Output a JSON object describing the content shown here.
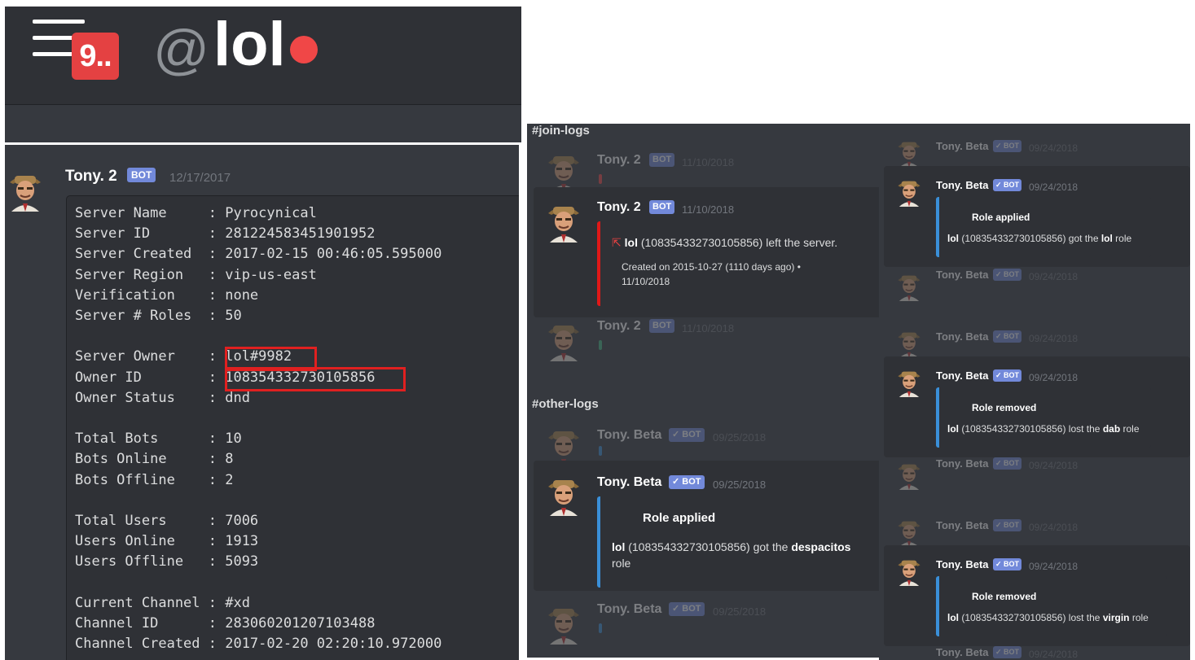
{
  "header": {
    "badge": "9..",
    "at_symbol": "@",
    "channel": "lol"
  },
  "serverinfo": {
    "author": "Tony. 2",
    "bot_tag": "BOT",
    "timestamp": "12/17/2017",
    "rows": [
      "Server Name     : Pyrocynical",
      "Server ID       : 281224583451901952",
      "Server Created  : 2017-02-15 00:46:05.595000",
      "Server Region   : vip-us-east",
      "Verification    : none",
      "Server # Roles  : 50",
      "",
      "Server Owner    : lol#9982",
      "Owner ID        : 108354332730105856",
      "Owner Status    : dnd",
      "",
      "Total Bots      : 10",
      "Bots Online     : 8",
      "Bots Offline    : 2",
      "",
      "Total Users     : 7006",
      "Users Online    : 1913",
      "Users Offline   : 5093",
      "",
      "Current Channel : #xd",
      "Channel ID      : 283060201207103488",
      "Channel Created : 2017-02-20 02:20:10.972000"
    ]
  },
  "logs": {
    "join_label": "#join-logs",
    "other_label": "#other-logs",
    "ghost1": {
      "author": "Tony. 2",
      "bot": "BOT",
      "ts": "11/10/2018"
    },
    "join_msg": {
      "author": "Tony. 2",
      "bot": "BOT",
      "ts": "11/10/2018",
      "user": "lol",
      "line1": " (108354332730105856) left the server.",
      "line2": "Created on 2015-10-27 (1110 days ago) •",
      "line3": "11/10/2018"
    },
    "ghost2": {
      "author": "Tony. 2",
      "bot": "BOT",
      "ts": "11/10/2018"
    },
    "ghost3": {
      "author": "Tony. Beta",
      "bot": "✓ BOT",
      "ts": "09/25/2018"
    },
    "other_msg": {
      "author": "Tony. Beta",
      "bot": "✓ BOT",
      "ts": "09/25/2018",
      "title": "Role applied",
      "user": "lol",
      "line1": " (108354332730105856) got the ",
      "role": "despacitos",
      "line2": "role"
    },
    "ghost4": {
      "author": "Tony. Beta",
      "bot": "✓ BOT",
      "ts": "09/25/2018"
    }
  },
  "roles": {
    "ghosts": [
      {
        "author": "Tony. Beta",
        "bot": "✓ BOT",
        "ts": "09/24/2018"
      }
    ],
    "messages": [
      {
        "author": "Tony. Beta",
        "bot": "✓ BOT",
        "ts": "09/24/2018",
        "title": "Role applied",
        "user": "lol",
        "text": " (108354332730105856) got the ",
        "role": "lol",
        "tail": " role"
      },
      {
        "author": "Tony. Beta",
        "bot": "✓ BOT",
        "ts": "09/24/2018",
        "title": "Role removed",
        "user": "lol",
        "text": " (108354332730105856) lost the ",
        "role": "dab",
        "tail": " role"
      },
      {
        "author": "Tony. Beta",
        "bot": "✓ BOT",
        "ts": "09/24/2018",
        "title": "Role removed",
        "user": "lol",
        "text": " (108354332730105856) lost the ",
        "role": "virgin",
        "tail": " role"
      }
    ]
  },
  "colors": {
    "background": "#36393f",
    "embed": "#2f3136",
    "blurple": "#7289da",
    "red_bar": "#f04747",
    "blue_bar": "#3a8fd8",
    "highlight": "#e02020"
  }
}
